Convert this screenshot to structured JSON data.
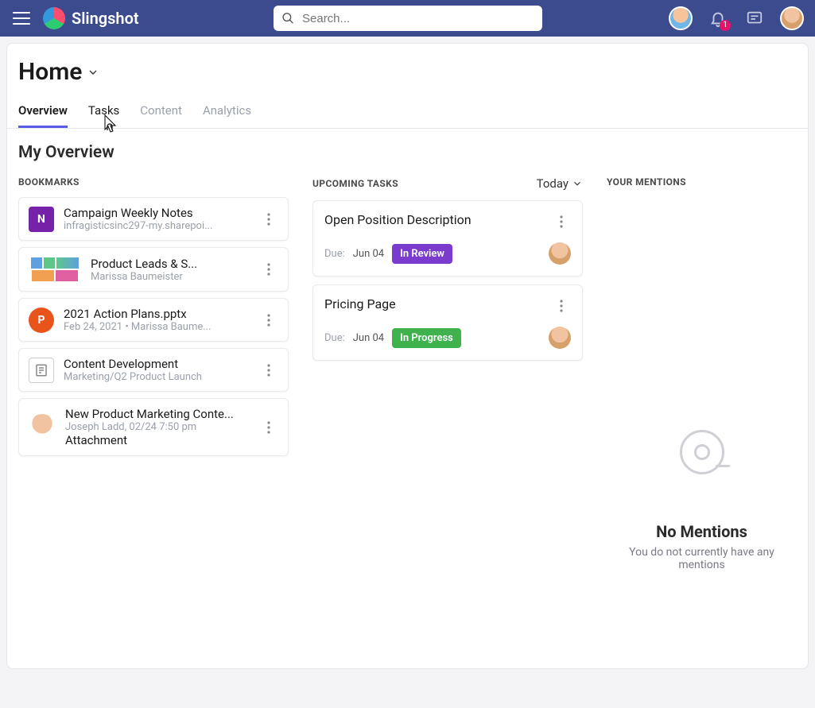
{
  "brand": "Slingshot",
  "search": {
    "placeholder": "Search..."
  },
  "notifications": {
    "count": "1"
  },
  "page": {
    "title": "Home",
    "tabs": [
      "Overview",
      "Tasks",
      "Content",
      "Analytics"
    ],
    "activeTab": 0,
    "hoverTab": 1,
    "sectionTitle": "My Overview"
  },
  "bookmarks": {
    "label": "BOOKMARKS",
    "items": [
      {
        "type": "onenote",
        "title": "Campaign Weekly Notes",
        "sub": "infragisticsinc297-my.sharepoi..."
      },
      {
        "type": "chart",
        "title": "Product Leads & S...",
        "sub": "Marissa Baumeister"
      },
      {
        "type": "ppt",
        "title": "2021 Action Plans.pptx",
        "sub": "Feb 24, 2021 • Marissa Baume..."
      },
      {
        "type": "doc",
        "title": "Content Development",
        "sub": "Marketing/Q2 Product Launch"
      },
      {
        "type": "avatar",
        "title": "New Product Marketing Conte...",
        "sub": "Joseph Ladd, 02/24 7:50 pm",
        "sub2": "Attachment"
      }
    ]
  },
  "tasks": {
    "label": "UPCOMING TASKS",
    "filter": "Today",
    "dueLabel": "Due:",
    "items": [
      {
        "title": "Open Position Description",
        "due": "Jun 04",
        "status": "In Review",
        "statusClass": "status-review"
      },
      {
        "title": "Pricing Page",
        "due": "Jun 04",
        "status": "In Progress",
        "statusClass": "status-progress"
      }
    ]
  },
  "mentions": {
    "label": "YOUR MENTIONS",
    "emptyTitle": "No Mentions",
    "emptyBody": "You do not currently have any mentions"
  }
}
